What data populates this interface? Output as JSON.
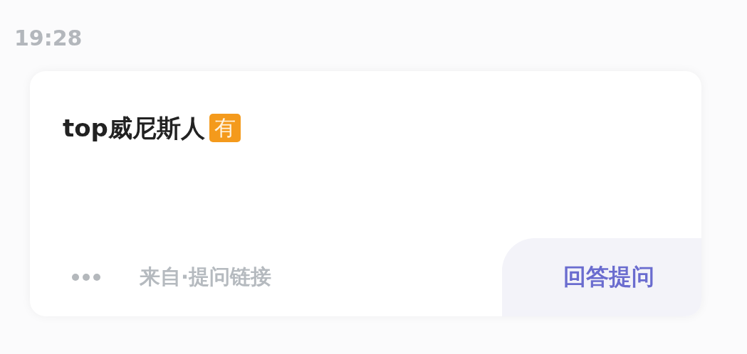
{
  "time": "19:28",
  "card": {
    "title": "top威尼斯人",
    "title_badge": "有",
    "source": "来自·提问链接",
    "action_button": "回答提问"
  }
}
